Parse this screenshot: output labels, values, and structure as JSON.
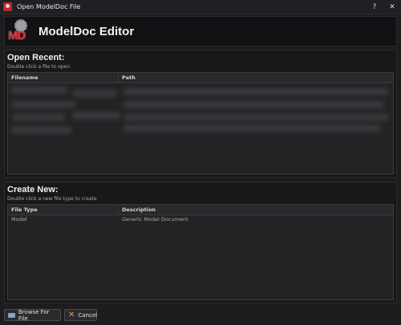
{
  "window": {
    "title": "Open ModelDoc File",
    "help_label": "?",
    "close_label": "✕"
  },
  "header": {
    "logo_text": "MD",
    "app_name": "ModelDoc Editor"
  },
  "open_recent": {
    "title": "Open Recent:",
    "subtitle": "Double click a file to open",
    "columns": [
      "Filename",
      "Path"
    ]
  },
  "create_new": {
    "title": "Create New:",
    "subtitle": "Double click a new file type to create",
    "columns": [
      "File Type",
      "Description"
    ],
    "rows": [
      {
        "type": "Model",
        "description": "Generic Model Document"
      }
    ]
  },
  "footer": {
    "browse_label": "Browse For File",
    "cancel_label": "Cancel"
  },
  "colors": {
    "brand_red": "#d8262b",
    "background": "#1d1d1f"
  }
}
